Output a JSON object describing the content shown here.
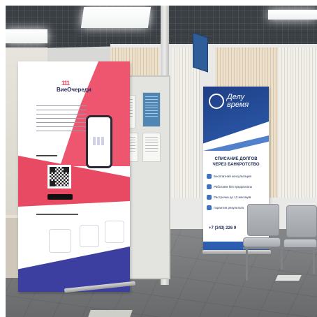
{
  "scene": {
    "kind": "office-lobby-photo",
    "colors": {
      "banner1_pink": "#e84a64",
      "banner1_purple": "#3d3fa0",
      "banner2_blue": "#2d5db0",
      "ceiling": "#3a3f44",
      "floor": "#7a7c7e"
    }
  },
  "banner_left": {
    "brand": "ВиеОчереди",
    "logo_mark": "111",
    "qr_icon": "qr-code-icon"
  },
  "banner_right": {
    "brand_line1": "Делу",
    "brand_line2": "время",
    "heading_line1": "СПИСАНИЕ ДОЛГОВ",
    "heading_line2": "ЧЕРЕЗ БАНКРОТСТВО",
    "items": [
      "Бесплатная консультация",
      "Работаем без предоплаты",
      "Рассрочка до 12 месяцев",
      "Гарантия результата"
    ],
    "phone": "+7 (343) 226 9"
  }
}
